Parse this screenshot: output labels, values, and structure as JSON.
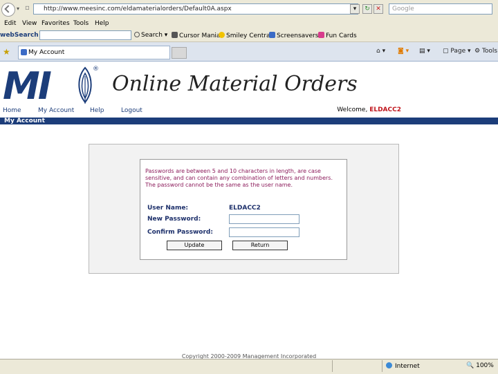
{
  "browser": {
    "url": "http://www.meesinc.com/eldamaterialorders/Default0A.aspx",
    "search_placeholder": "Google",
    "menu": [
      "Edit",
      "View",
      "Favorites",
      "Tools",
      "Help"
    ],
    "toolbar": {
      "brand": "webSearch",
      "search_label": "Search",
      "items": [
        "Cursor Mania",
        "Smiley Central",
        "Screensavers",
        "Fun Cards"
      ]
    },
    "tab_title": "My Account",
    "command_page": "Page",
    "command_tools": "Tools"
  },
  "page": {
    "logo_text": "MI",
    "logo_registered": "®",
    "site_title": "Online Material Orders",
    "nav": [
      "Home",
      "My Account",
      "Help",
      "Logout"
    ],
    "welcome_prefix": "Welcome,",
    "welcome_user": "ELDACC2",
    "section_title": "My Account",
    "password_rules": "Passwords are between 5 and 10 characters in length, are case sensitive, and can contain any combination of letters and numbers.",
    "password_rule_2": "The password cannot be the same as the user name.",
    "form": {
      "username_label": "User Name:",
      "username_value": "ELDACC2",
      "new_password_label": "New Password:",
      "confirm_password_label": "Confirm Password:",
      "update_label": "Update",
      "return_label": "Return"
    },
    "copyright": "Copyright 2000-2009 Management Incorporated"
  },
  "status": {
    "zone": "Internet",
    "zoom": "100%"
  },
  "colors": {
    "brand_blue": "#1c3d7a",
    "rule_text": "#8b1a5a",
    "welcome_user": "#c0151c"
  }
}
